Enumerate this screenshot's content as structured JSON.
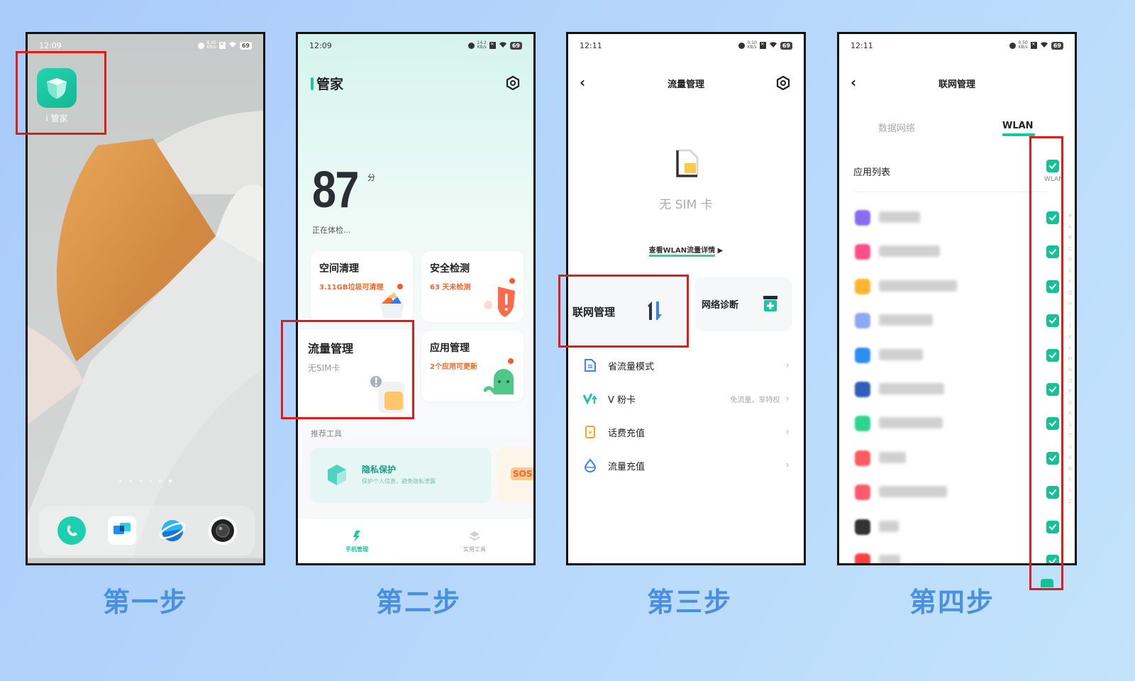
{
  "colors": {
    "accent_green": "#17c196",
    "highlight_red": "#e01b1b",
    "warning_orange": "#ef6a2a",
    "step_label_blue": "#4a90e2"
  },
  "steps": [
    {
      "label": "第一步"
    },
    {
      "label": "第二步"
    },
    {
      "label": "第三步"
    },
    {
      "label": "第四步"
    }
  ],
  "phone1": {
    "status": {
      "time": "12:09",
      "speed_top": "6.40",
      "speed_bottom": "KB/s",
      "battery": "69"
    },
    "app": {
      "label": "i 管家",
      "icon": "shield-cube-icon"
    },
    "page_dots": {
      "count": 6,
      "active_index": 5
    },
    "dock": [
      {
        "name": "phone-icon"
      },
      {
        "name": "messages-icon"
      },
      {
        "name": "browser-icon"
      },
      {
        "name": "camera-icon"
      }
    ]
  },
  "phone2": {
    "status": {
      "time": "12:09",
      "speed_top": "14.2",
      "speed_bottom": "KB/s",
      "battery": "69"
    },
    "title": "管家",
    "title_prefix": "i",
    "score": "87",
    "score_unit": "分",
    "checking": "正在体检...",
    "cards": [
      {
        "title": "空间清理",
        "subtitle": "3.11GB垃圾可清理"
      },
      {
        "title": "安全检测",
        "subtitle": "63 天未检测"
      },
      {
        "title": "流量管理",
        "subtitle": "无SIM卡"
      },
      {
        "title": "应用管理",
        "subtitle": "2个应用可更新"
      }
    ],
    "section_label": "推荐工具",
    "tool": {
      "title": "隐私保护",
      "subtitle": "保护个人信息，避免隐私泄露"
    },
    "tool2": {
      "badge": "SOS"
    },
    "nav": [
      {
        "label": "手机管理",
        "active": true
      },
      {
        "label": "实用工具",
        "active": false
      }
    ]
  },
  "phone3": {
    "status": {
      "time": "12:11",
      "speed_top": "0.10",
      "speed_bottom": "KB/s",
      "battery": "69"
    },
    "title": "流量管理",
    "no_sim": "无 SIM 卡",
    "wlan_link": "查看WLAN流量详情",
    "tiles": [
      {
        "label": "联网管理"
      },
      {
        "label": "网络诊断"
      }
    ],
    "list": [
      {
        "label": "省流量模式",
        "aux": ""
      },
      {
        "label": "V 粉卡",
        "aux": "免流量，享特权"
      },
      {
        "label": "话费充值",
        "aux": ""
      },
      {
        "label": "流量充值",
        "aux": ""
      }
    ]
  },
  "phone4": {
    "status": {
      "time": "12:11",
      "speed_top": "0.50",
      "speed_bottom": "KB/s",
      "battery": "69"
    },
    "title": "联网管理",
    "tabs": [
      {
        "label": "数据网络",
        "active": false
      },
      {
        "label": "WLAN",
        "active": true
      }
    ],
    "list_header": "应用列表",
    "column_label": "WLAN",
    "select_all_checked": true,
    "apps": [
      {
        "icon_color": "#8a6cf0",
        "checked": true
      },
      {
        "icon_color": "#ff4f8b",
        "checked": true
      },
      {
        "icon_color": "#ffb531",
        "checked": true
      },
      {
        "icon_color": "#8fa8f5",
        "checked": true
      },
      {
        "icon_color": "#2b8ff2",
        "checked": true
      },
      {
        "icon_color": "#2f5fb8",
        "checked": true
      },
      {
        "icon_color": "#2dd48f",
        "checked": true
      },
      {
        "icon_color": "#ff5a5f",
        "checked": true
      },
      {
        "icon_color": "#ff5a6e",
        "checked": true
      },
      {
        "icon_color": "#333333",
        "checked": true
      },
      {
        "icon_color": "#ff4040",
        "checked": true
      }
    ],
    "alpha_index": [
      "#",
      "A",
      "B",
      "C",
      "D",
      "E",
      "F",
      "G",
      "H",
      "I",
      "J",
      "K",
      "L",
      "M",
      "N",
      "O",
      "P",
      "Q",
      "R",
      "S",
      "T",
      "U",
      "V",
      "W",
      "X",
      "Y",
      "Z"
    ]
  }
}
